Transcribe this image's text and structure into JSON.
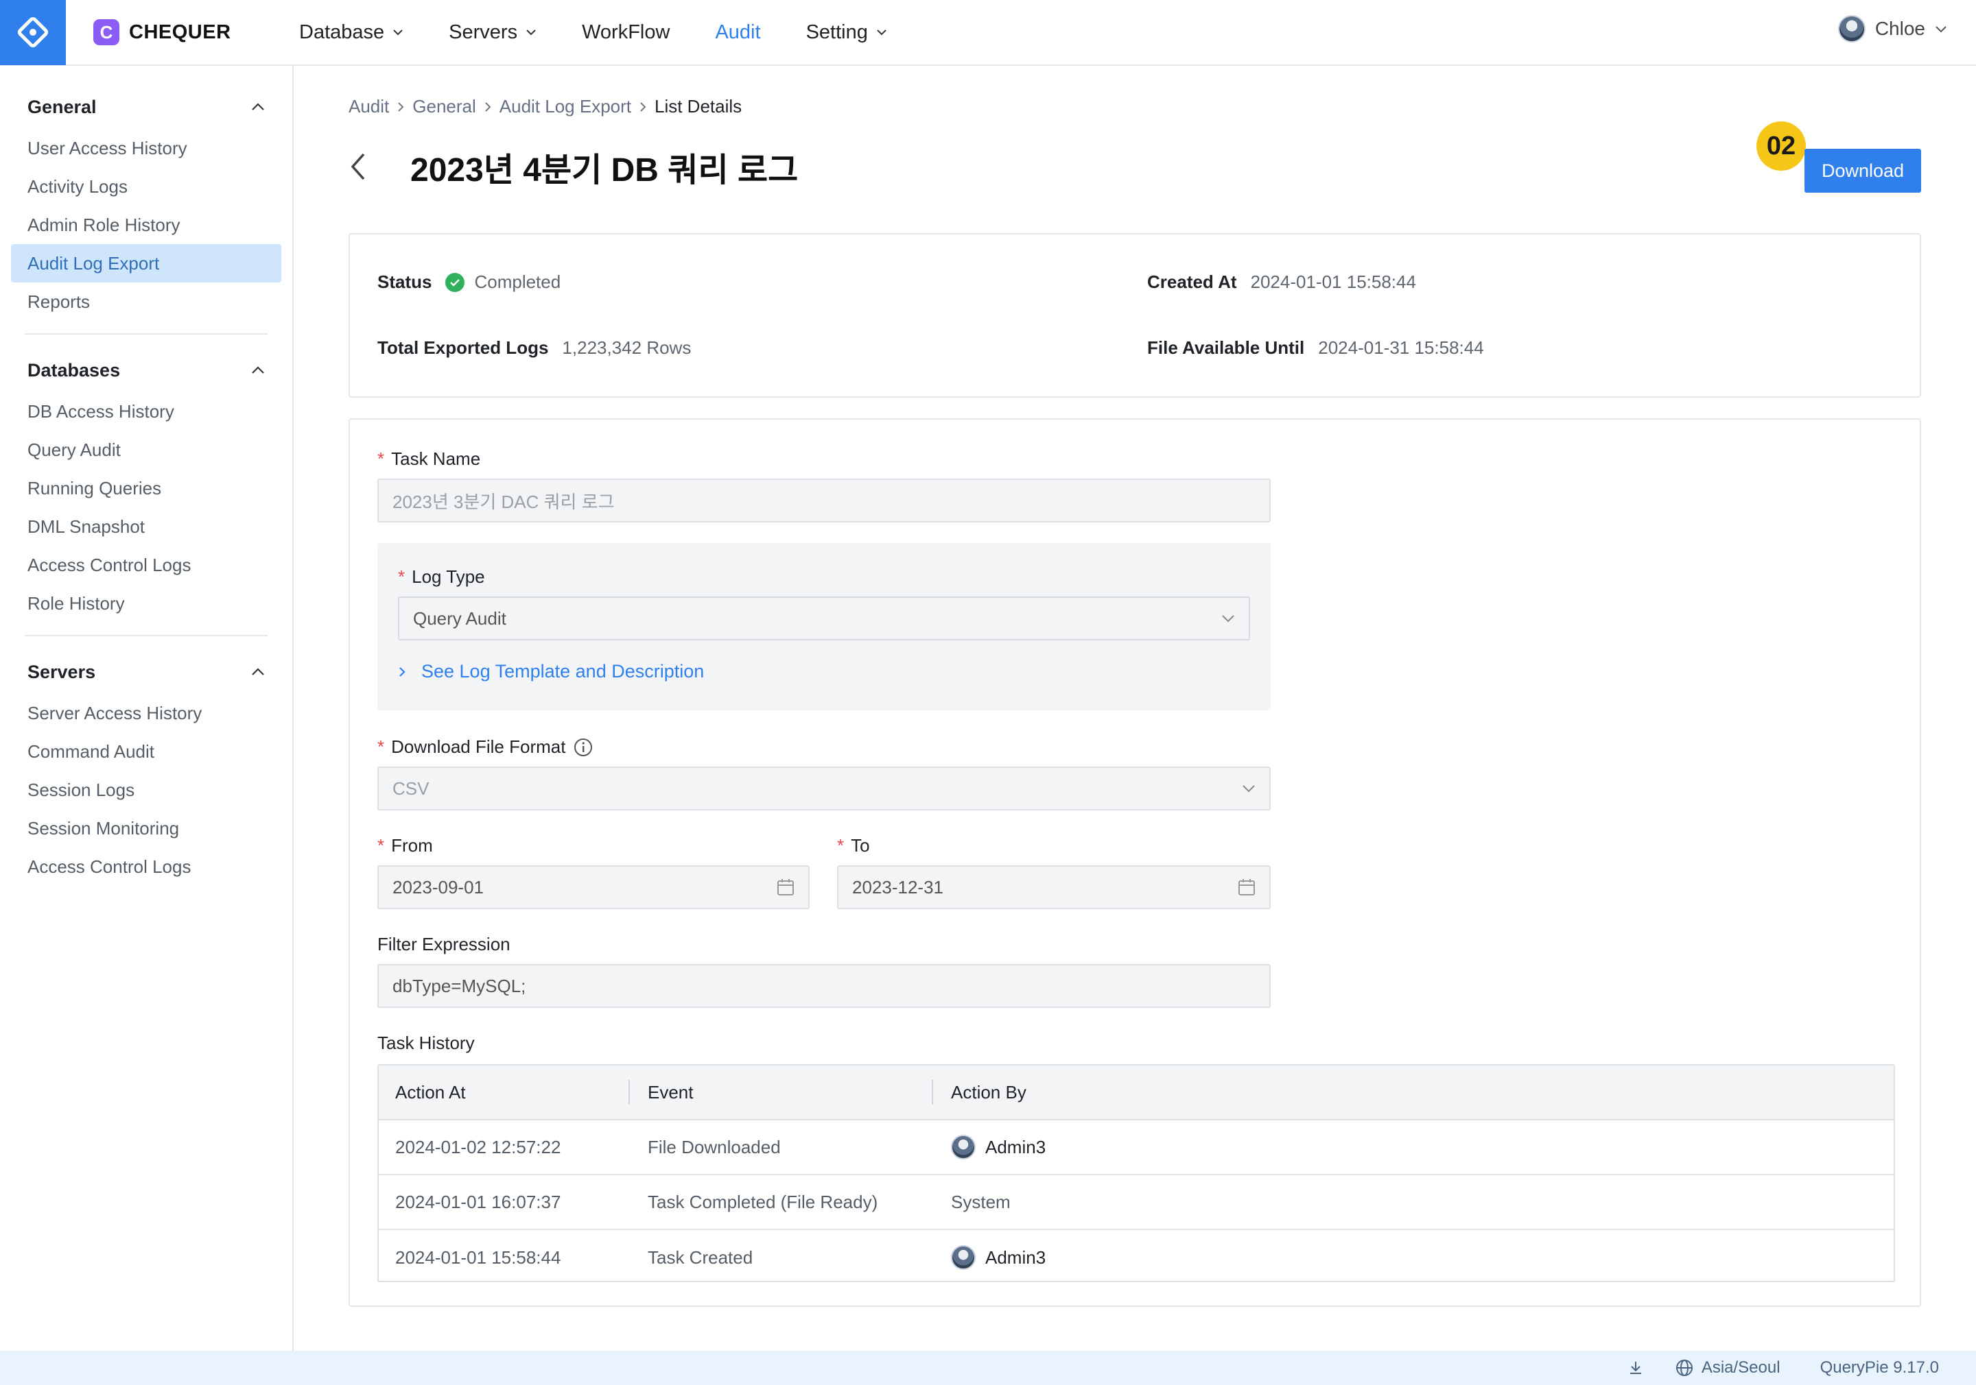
{
  "org": {
    "badge": "C",
    "name": "CHEQUER"
  },
  "nav": [
    {
      "label": "Database",
      "dropdown": true
    },
    {
      "label": "Servers",
      "dropdown": true
    },
    {
      "label": "WorkFlow",
      "dropdown": false
    },
    {
      "label": "Audit",
      "dropdown": false,
      "active": true
    },
    {
      "label": "Setting",
      "dropdown": true
    }
  ],
  "user": {
    "name": "Chloe"
  },
  "sidebar": {
    "general": {
      "title": "General",
      "items": [
        "User Access History",
        "Activity Logs",
        "Admin Role History",
        "Audit Log Export",
        "Reports"
      ]
    },
    "databases": {
      "title": "Databases",
      "items": [
        "DB Access History",
        "Query Audit",
        "Running Queries",
        "DML Snapshot",
        "Access Control Logs",
        "Role History"
      ]
    },
    "servers": {
      "title": "Servers",
      "items": [
        "Server Access History",
        "Command Audit",
        "Session Logs",
        "Session Monitoring",
        "Access Control Logs"
      ]
    }
  },
  "breadcrumb": [
    "Audit",
    "General",
    "Audit Log Export",
    "List Details"
  ],
  "page": {
    "title": "2023년 4분기 DB 쿼리 로그"
  },
  "actions": {
    "download": "Download",
    "step_badge": "02"
  },
  "info": {
    "status_label": "Status",
    "status_value": "Completed",
    "created_label": "Created At",
    "created_value": "2024-01-01 15:58:44",
    "total_label": "Total Exported Logs",
    "total_value": "1,223,342 Rows",
    "available_label": "File Available Until",
    "available_value": "2024-01-31 15:58:44"
  },
  "form": {
    "task_name_label": "Task Name",
    "task_name_placeholder": "2023년 3분기 DAC 쿼리 로그",
    "log_type_label": "Log Type",
    "log_type_value": "Query Audit",
    "template_link": "See Log Template and Description",
    "format_label": "Download File Format",
    "format_value": "CSV",
    "from_label": "From",
    "from_value": "2023-09-01",
    "to_label": "To",
    "to_value": "2023-12-31",
    "filter_label": "Filter Expression",
    "filter_value": "dbType=MySQL;",
    "history_label": "Task History"
  },
  "history": {
    "columns": [
      "Action At",
      "Event",
      "Action By"
    ],
    "rows": [
      {
        "at": "2024-01-02 12:57:22",
        "event": "File Downloaded",
        "by": "Admin3",
        "avatar": true
      },
      {
        "at": "2024-01-01 16:07:37",
        "event": "Task Completed (File Ready)",
        "by": "System",
        "avatar": false
      },
      {
        "at": "2024-01-01 15:58:44",
        "event": "Task Created",
        "by": "Admin3",
        "avatar": true
      }
    ]
  },
  "footer": {
    "timezone": "Asia/Seoul",
    "version": "QueryPie 9.17.0"
  },
  "colors": {
    "accent": "#2f80ed",
    "success": "#2fb15c",
    "required": "#e5484d",
    "badge": "#f5c518",
    "org": "#8b5cf6"
  },
  "icons": [
    "querypie-logo-icon",
    "chevron-down-icon",
    "chevron-up-icon",
    "chevron-left-icon",
    "chevron-right-icon",
    "check-circle-icon",
    "info-icon",
    "calendar-icon",
    "download-icon",
    "globe-icon"
  ]
}
